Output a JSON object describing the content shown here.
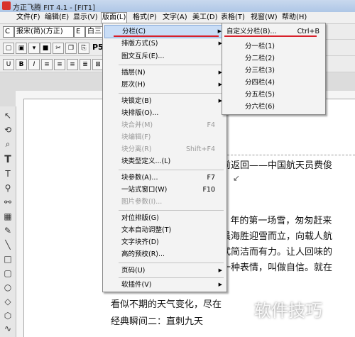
{
  "window": {
    "title": "方正飞腾 FIT 4.1 - [FIT1]"
  },
  "menubar": {
    "items": [
      "文件(F)",
      "编辑(E)",
      "显示(V)",
      "版面(L)",
      "格式(P)",
      "文字(A)",
      "美工(D)",
      "表格(T)",
      "视窗(W)",
      "帮助(H)"
    ]
  },
  "toolbar": {
    "font_prefix": "C",
    "font_name": "报宋(简)(方正)",
    "font_prefix2": "E",
    "font_name2": "白三",
    "row2_label": "P5",
    "row3_b": "B",
    "row3_i": "I"
  },
  "layout_menu": {
    "items": [
      {
        "label": "分栏(C)",
        "shortcut": "",
        "arrow": true,
        "disabled": false,
        "highlight": true
      },
      {
        "label": "排版方式(S)",
        "shortcut": "",
        "arrow": true,
        "disabled": false
      },
      {
        "label": "图文互斥(E)...",
        "shortcut": "",
        "arrow": false,
        "disabled": false
      },
      {
        "label": "插层(N)",
        "shortcut": "",
        "arrow": true,
        "disabled": false
      },
      {
        "label": "层次(H)",
        "shortcut": "",
        "arrow": true,
        "disabled": false
      },
      {
        "label": "块锁定(B)",
        "shortcut": "",
        "arrow": true,
        "disabled": false
      },
      {
        "label": "块排版(O)...",
        "shortcut": "",
        "arrow": false,
        "disabled": false
      },
      {
        "label": "块合并(M)",
        "shortcut": "F4",
        "arrow": false,
        "disabled": true
      },
      {
        "label": "块编辑(F)",
        "shortcut": "",
        "arrow": false,
        "disabled": true
      },
      {
        "label": "块分离(R)",
        "shortcut": "Shift+F4",
        "arrow": false,
        "disabled": true
      },
      {
        "label": "块类型定义...(L)",
        "shortcut": "",
        "arrow": false,
        "disabled": false
      },
      {
        "label": "块参数(A)...",
        "shortcut": "F7",
        "arrow": false,
        "disabled": false
      },
      {
        "label": "一站式窗口(W)",
        "shortcut": "F10",
        "arrow": false,
        "disabled": false
      },
      {
        "label": "图片参数(I)...",
        "shortcut": "",
        "arrow": false,
        "disabled": true
      },
      {
        "label": "对位排版(G)",
        "shortcut": "",
        "arrow": false,
        "disabled": false
      },
      {
        "label": "文本自动调整(T)",
        "shortcut": "",
        "arrow": false,
        "disabled": false
      },
      {
        "label": "文字块齐(D)",
        "shortcut": "",
        "arrow": false,
        "disabled": false
      },
      {
        "label": "高的预校(R)...",
        "shortcut": "",
        "arrow": false,
        "disabled": false
      },
      {
        "label": "页码(U)",
        "shortcut": "",
        "arrow": true,
        "disabled": false
      },
      {
        "label": "软插件(V)",
        "shortcut": "",
        "arrow": true,
        "disabled": false
      }
    ]
  },
  "column_submenu": {
    "items": [
      {
        "label": "自定义分栏(B)...",
        "shortcut": "Ctrl+B"
      },
      {
        "label": "分一栏(1)",
        "shortcut": ""
      },
      {
        "label": "分二栏(2)",
        "shortcut": ""
      },
      {
        "label": "分三栏(3)",
        "shortcut": ""
      },
      {
        "label": "分四栏(4)",
        "shortcut": ""
      },
      {
        "label": "分五栏(5)",
        "shortcut": ""
      },
      {
        "label": "分六栏(6)",
        "shortcut": ""
      }
    ]
  },
  "document": {
    "lines": [
      "前返回——中国航天员费俊",
      "5 年的第一场雪，匆匆赶来",
      "晨海胜迎雪而立，向载人航",
      "式简洁而有力。让人回味的",
      "一种表情，叫做自信。就在",
      "看似不期的天气变化，尽在",
      "经典瞬间二：直刺九天"
    ]
  },
  "watermark": {
    "text": "软件技巧"
  },
  "colors": {
    "accent_red": "#d8202a",
    "highlight": "#c9ddf6"
  }
}
